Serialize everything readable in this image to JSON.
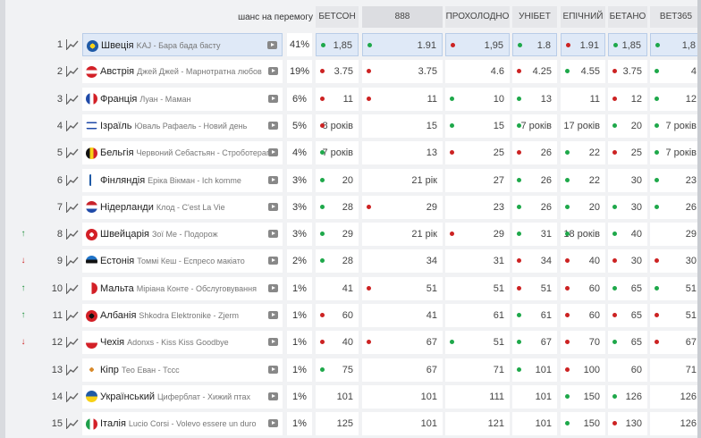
{
  "header": {
    "chance_label": "шанс на перемогу",
    "bookmakers": [
      "БЕТСОН",
      "888",
      "ПРОХОЛОДНО",
      "УНІБЕТ",
      "ЕПІЧНИЙ",
      "БЕТАНО",
      "BET365"
    ]
  },
  "colors": {
    "green": "#1ea84a",
    "red": "#cc2222",
    "selected": "#dfe9f7"
  },
  "icons": {
    "graph": "line-chart-icon",
    "play": "video-play-icon",
    "trend_up": "arrow-up-icon",
    "trend_down": "arrow-down-icon"
  },
  "rows": [
    {
      "num": "1",
      "trend": "",
      "country": "Швеція",
      "artist": "KAJ - Бара бада басту",
      "chance": "41%",
      "odds": [
        "1,85",
        "1.91",
        "1,95",
        "1.8",
        "1.91",
        "1,85",
        "1,8"
      ],
      "dots": [
        "g",
        "g",
        "r",
        "g",
        "r",
        "g",
        "g"
      ],
      "flag": "se"
    },
    {
      "num": "2",
      "trend": "",
      "country": "Австрія",
      "artist": "Джей Джей - Марнотратна любов",
      "chance": "19%",
      "odds": [
        "3.75",
        "3.75",
        "4.6",
        "4.25",
        "4.55",
        "3.75",
        "4"
      ],
      "dots": [
        "r",
        "r",
        "",
        "r",
        "g",
        "r",
        "g"
      ],
      "flag": "at"
    },
    {
      "num": "3",
      "trend": "",
      "country": "Франція",
      "artist": "Луан - Маман",
      "chance": "6%",
      "odds": [
        "11",
        "11",
        "10",
        "13",
        "11",
        "12",
        "12"
      ],
      "dots": [
        "r",
        "r",
        "g",
        "g",
        "",
        "r",
        "g"
      ],
      "flag": "fr"
    },
    {
      "num": "4",
      "trend": "",
      "country": "Ізраїль",
      "artist": "Юваль Рафаель - Новий день",
      "chance": "5%",
      "odds": [
        "8 років",
        "15",
        "15",
        "7 років",
        "17 років",
        "20",
        "7 років"
      ],
      "dots": [
        "r",
        "",
        "g",
        "g",
        "",
        "g",
        "g"
      ],
      "flag": "il"
    },
    {
      "num": "5",
      "trend": "",
      "country": "Бельгія",
      "artist": "Червоний Себастьян - Строботерапія",
      "chance": "4%",
      "odds": [
        "7 років",
        "13",
        "25",
        "26",
        "22",
        "25",
        "7 років"
      ],
      "dots": [
        "g",
        "",
        "r",
        "r",
        "g",
        "r",
        "g"
      ],
      "flag": "be"
    },
    {
      "num": "6",
      "trend": "",
      "country": "Фінляндія",
      "artist": "Еріка Вікман - Ich komme",
      "chance": "3%",
      "odds": [
        "20",
        "21 рік",
        "27",
        "26",
        "22",
        "30",
        "23"
      ],
      "dots": [
        "g",
        "",
        "",
        "g",
        "g",
        "",
        "g"
      ],
      "flag": "fi"
    },
    {
      "num": "7",
      "trend": "",
      "country": "Нідерланди",
      "artist": "Клод - C'est La Vie",
      "chance": "3%",
      "odds": [
        "28",
        "29",
        "23",
        "26",
        "20",
        "30",
        "26"
      ],
      "dots": [
        "g",
        "r",
        "",
        "g",
        "g",
        "g",
        "g"
      ],
      "flag": "nl"
    },
    {
      "num": "8",
      "trend": "up",
      "country": "Швейцарія",
      "artist": "Зої Ме - Подорож",
      "chance": "3%",
      "odds": [
        "29",
        "21 рік",
        "29",
        "31",
        "18 років",
        "40",
        "29"
      ],
      "dots": [
        "g",
        "",
        "r",
        "g",
        "g",
        "g",
        ""
      ],
      "flag": "ch"
    },
    {
      "num": "9",
      "trend": "down",
      "country": "Естонія",
      "artist": "Томмі Кеш - Еспресо макіато",
      "chance": "2%",
      "odds": [
        "28",
        "34",
        "31",
        "34",
        "40",
        "30",
        "30"
      ],
      "dots": [
        "g",
        "",
        "",
        "r",
        "r",
        "r",
        "r"
      ],
      "flag": "ee"
    },
    {
      "num": "10",
      "trend": "up",
      "country": "Мальта",
      "artist": "Міріана Конте - Обслуговування",
      "chance": "1%",
      "odds": [
        "41",
        "51",
        "51",
        "51",
        "60",
        "65",
        "51"
      ],
      "dots": [
        "",
        "r",
        "",
        "r",
        "r",
        "g",
        "g"
      ],
      "flag": "mt"
    },
    {
      "num": "11",
      "trend": "up",
      "country": "Албанія",
      "artist": "Shkodra Elektronike - Zjerm",
      "chance": "1%",
      "odds": [
        "60",
        "41",
        "61",
        "61",
        "60",
        "65",
        "51"
      ],
      "dots": [
        "r",
        "",
        "",
        "g",
        "r",
        "r",
        "r"
      ],
      "flag": "al"
    },
    {
      "num": "12",
      "trend": "down",
      "country": "Чехія",
      "artist": "Adonxs - Kiss Kiss Goodbye",
      "chance": "1%",
      "odds": [
        "40",
        "67",
        "51",
        "67",
        "70",
        "65",
        "67"
      ],
      "dots": [
        "r",
        "r",
        "g",
        "g",
        "r",
        "g",
        "r"
      ],
      "flag": "cz"
    },
    {
      "num": "13",
      "trend": "",
      "country": "Кіпр",
      "artist": "Тео Еван - Тссс",
      "chance": "1%",
      "odds": [
        "75",
        "67",
        "71",
        "101",
        "100",
        "60",
        "71"
      ],
      "dots": [
        "g",
        "",
        "",
        "g",
        "r",
        "",
        ""
      ],
      "flag": "cy"
    },
    {
      "num": "14",
      "trend": "",
      "country": "Український",
      "artist": "Циферблат - Хижий птах",
      "chance": "1%",
      "odds": [
        "101",
        "101",
        "111",
        "101",
        "150",
        "126",
        "126"
      ],
      "dots": [
        "",
        "",
        "",
        "",
        "g",
        "g",
        ""
      ],
      "flag": "ua"
    },
    {
      "num": "15",
      "trend": "",
      "country": "Італія",
      "artist": "Lucio Corsi - Volevo essere un duro",
      "chance": "1%",
      "odds": [
        "125",
        "101",
        "121",
        "101",
        "150",
        "130",
        "126"
      ],
      "dots": [
        "",
        "",
        "",
        "",
        "g",
        "r",
        ""
      ],
      "flag": "it"
    }
  ]
}
